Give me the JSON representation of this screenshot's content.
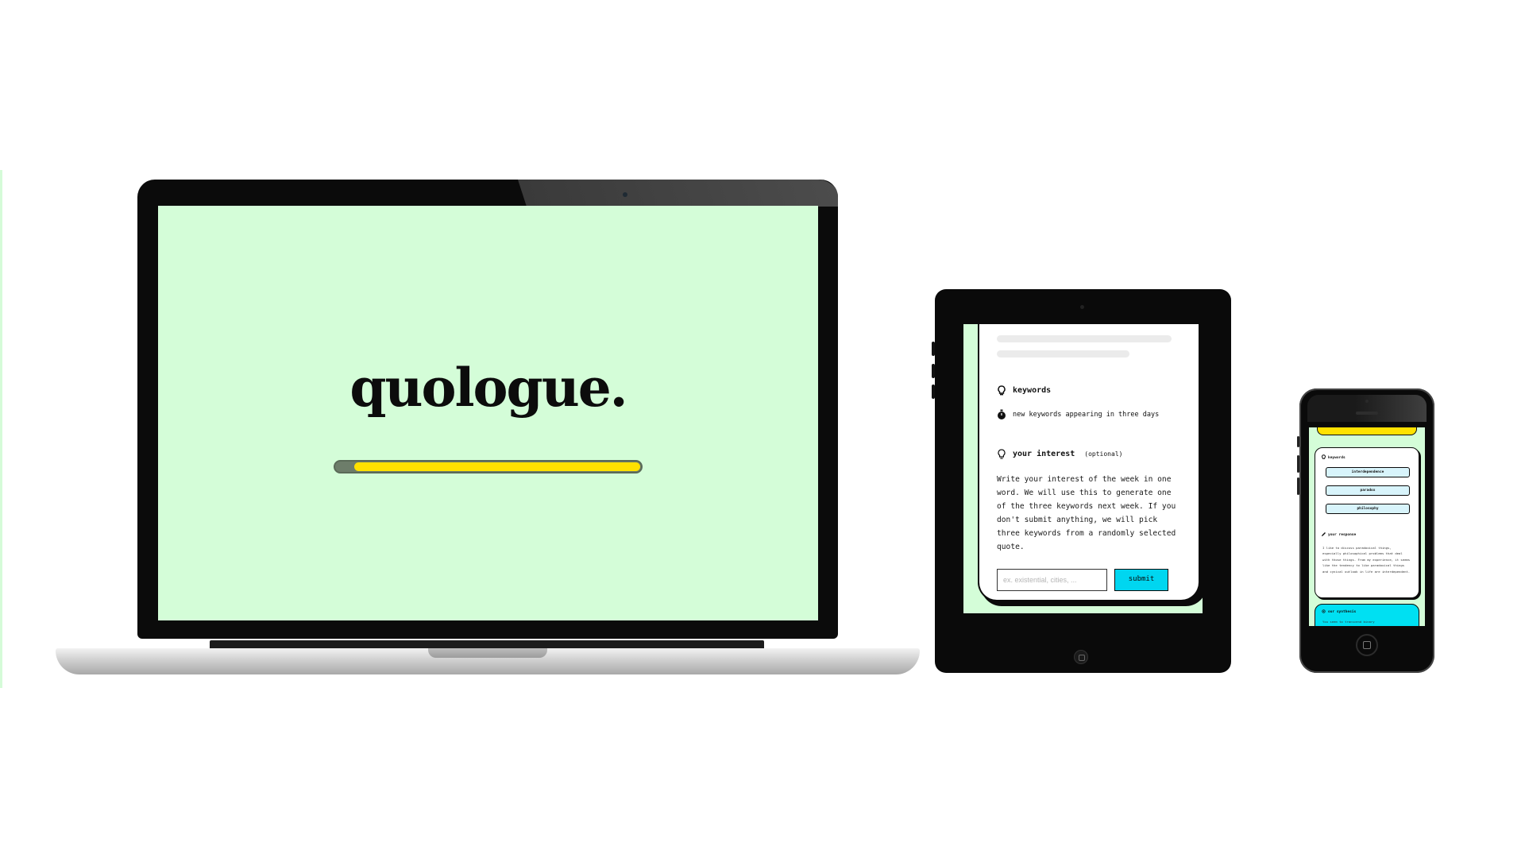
{
  "laptop": {
    "logo": "quologue.",
    "loading_progress_percent": 94
  },
  "tablet": {
    "keywords_title": "keywords",
    "timer_text": "new keywords appearing in three days",
    "interest_title": "your interest",
    "interest_optional": "(optional)",
    "interest_body": "Write your interest of the week in one word. We will use this to generate one of the three keywords next week. If you don't submit anything, we will pick three keywords from a randomly selected quote.",
    "input_placeholder": "ex. existential, cities, ...",
    "submit_label": "submit"
  },
  "phone": {
    "keywords_title": "keywords",
    "keywords": [
      "interdependence",
      "paradox",
      "philosophy"
    ],
    "response_title": "your response",
    "response_body": "I like to discuss paradoxical things, especially philosophical problems that deal with those things. From my experience, it seems like the tendency to like paradoxical things and cynical outlook in life are interdependent.",
    "synthesis_title": "our synthesis",
    "synthesis_body": "You seem to transcend binary"
  },
  "colors": {
    "screen_bg": "#d4fdd8",
    "accent_yellow": "#ffe100",
    "accent_cyan": "#00d6f0",
    "ink": "#0a0a0a"
  },
  "icons": {
    "keywords": "lightbulb-icon",
    "timer": "stopwatch-icon",
    "interest": "lightbulb-outline-icon",
    "synthesis": "gear-icon"
  }
}
